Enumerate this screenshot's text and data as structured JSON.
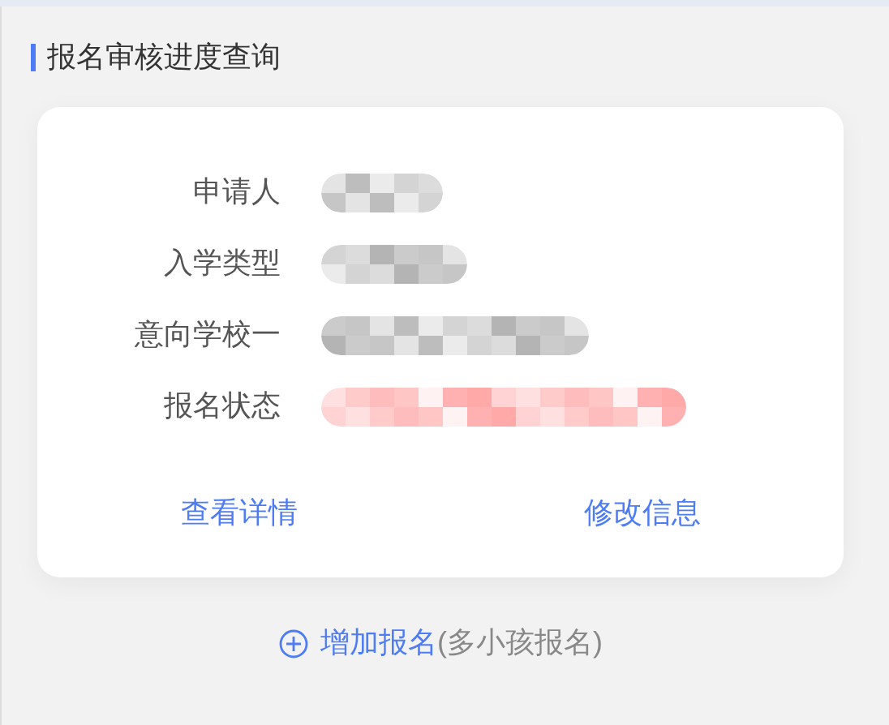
{
  "section_title": "报名审核进度查询",
  "fields": [
    {
      "label": "申请人",
      "kind": "text"
    },
    {
      "label": "入学类型",
      "kind": "text"
    },
    {
      "label": "意向学校一",
      "kind": "text"
    },
    {
      "label": "报名状态",
      "kind": "status"
    }
  ],
  "card_actions": [
    "查看详情",
    "修改信息"
  ],
  "add_link": {
    "label": "增加报名",
    "note": "(多小孩报名)"
  }
}
